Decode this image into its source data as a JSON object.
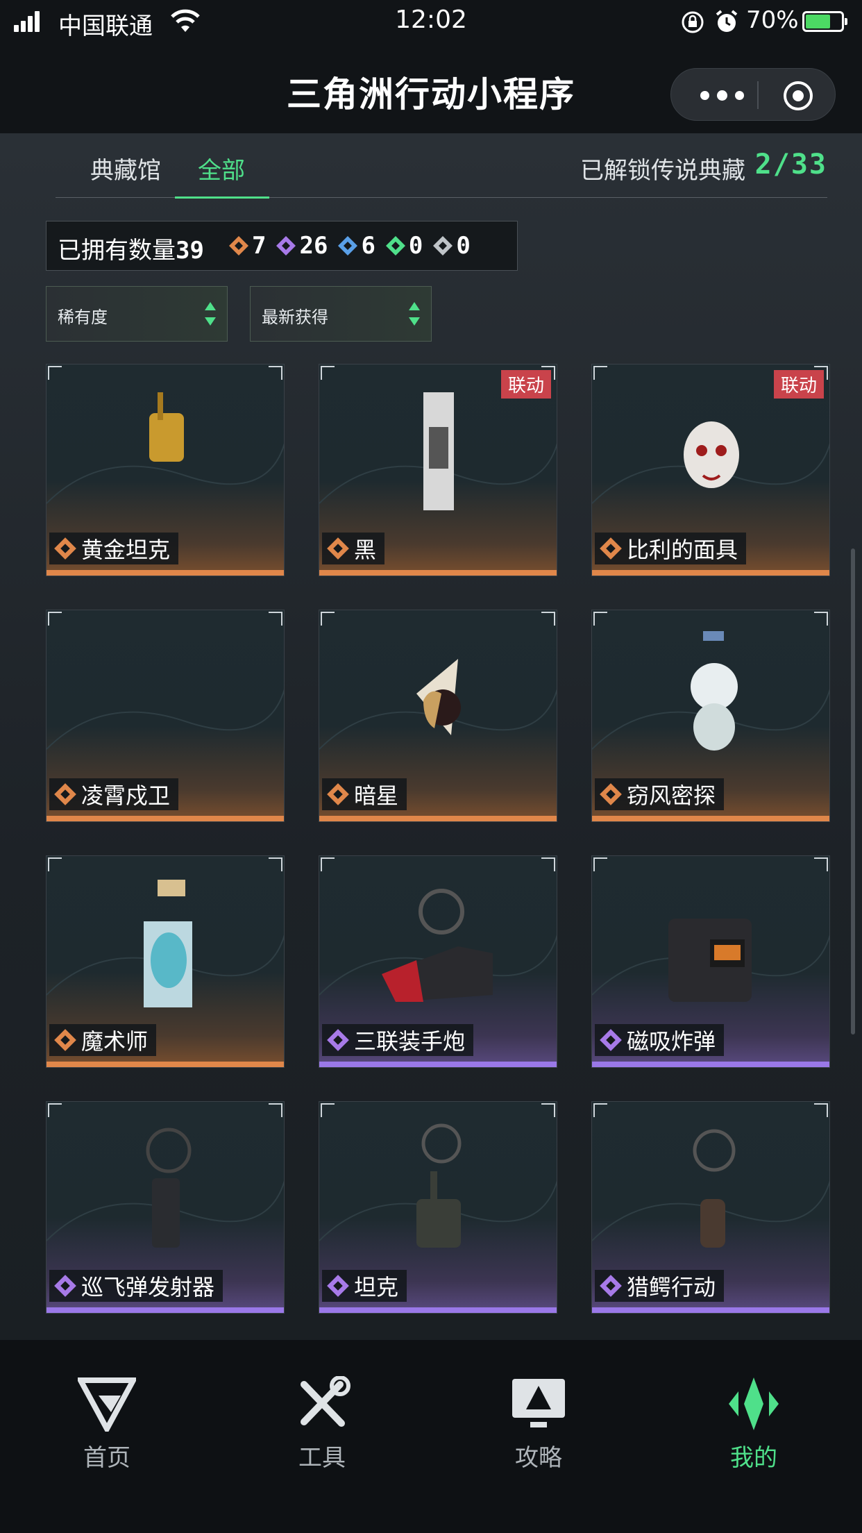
{
  "status_bar": {
    "carrier": "中国联通",
    "time": "12:02",
    "battery": "70%",
    "battery_level": 0.7
  },
  "title_bar": {
    "title": "三角洲行动小程序",
    "more_icon": "more-dots-icon",
    "close_icon": "target-close-icon"
  },
  "tabs": {
    "museum": "典藏馆",
    "all": "全部",
    "unlock_label": "已解锁传说典藏",
    "unlock_value": "2/33"
  },
  "owned": {
    "label": "已拥有数量",
    "total": "39",
    "counts": [
      {
        "icon": "orange-diamond-icon",
        "value": "7",
        "color": "#e0874a"
      },
      {
        "icon": "purple-diamond-icon",
        "value": "26",
        "color": "#a77ae8"
      },
      {
        "icon": "blue-diamond-icon",
        "value": "6",
        "color": "#5aa0e8"
      },
      {
        "icon": "green-diamond-icon",
        "value": "0",
        "color": "#4fe08a"
      },
      {
        "icon": "gray-diamond-icon",
        "value": "0",
        "color": "#bfc4c8"
      }
    ]
  },
  "sort": {
    "rarity": "稀有度",
    "newest": "最新获得"
  },
  "cards": [
    {
      "name": "黄金坦克",
      "rarity": "orange",
      "collab": ""
    },
    {
      "name": "黑",
      "rarity": "orange",
      "collab": "联动"
    },
    {
      "name": "比利的面具",
      "rarity": "orange",
      "collab": "联动"
    },
    {
      "name": "凌霄戍卫",
      "rarity": "orange",
      "collab": ""
    },
    {
      "name": "暗星",
      "rarity": "orange",
      "collab": ""
    },
    {
      "name": "窃风密探",
      "rarity": "orange",
      "collab": ""
    },
    {
      "name": "魔术师",
      "rarity": "orange",
      "collab": ""
    },
    {
      "name": "三联装手炮",
      "rarity": "purple",
      "collab": ""
    },
    {
      "name": "磁吸炸弹",
      "rarity": "purple",
      "collab": ""
    },
    {
      "name": "巡飞弹发射器",
      "rarity": "purple",
      "collab": ""
    },
    {
      "name": "坦克",
      "rarity": "purple",
      "collab": ""
    },
    {
      "name": "猎鳄行动",
      "rarity": "purple",
      "collab": ""
    }
  ],
  "bottom_nav": {
    "home": "首页",
    "tools": "工具",
    "guide": "攻略",
    "mine": "我的"
  },
  "colors": {
    "accent": "#4fe08a",
    "orange_rarity": "#e0874a",
    "purple_rarity": "#9a78e8",
    "collab_badge": "#c9434b"
  }
}
